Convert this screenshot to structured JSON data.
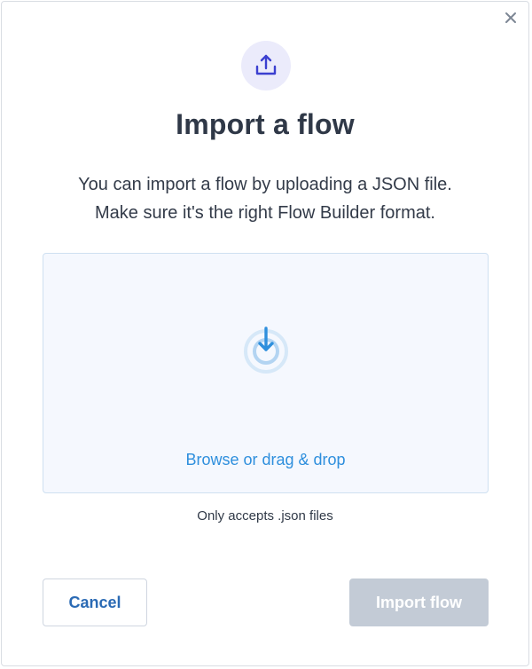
{
  "dialog": {
    "title": "Import a flow",
    "description_line1": "You can import a flow by uploading a JSON file.",
    "description_line2": "Make sure it's the right Flow Builder format.",
    "close_icon": "close-icon",
    "header_icon": "upload-icon"
  },
  "dropzone": {
    "icon": "download-target-icon",
    "browse_label": "Browse or drag & drop",
    "hint": "Only accepts .json files"
  },
  "actions": {
    "cancel_label": "Cancel",
    "import_label": "Import flow",
    "import_enabled": false
  },
  "colors": {
    "title": "#2f3847",
    "link": "#2e8fdd",
    "header_icon_bg": "#ebebfb",
    "header_icon": "#3b3fd0",
    "dropzone_bg": "#f5f8fe",
    "disabled_button": "#c3cbd6",
    "cancel_text": "#2a6ab4"
  }
}
